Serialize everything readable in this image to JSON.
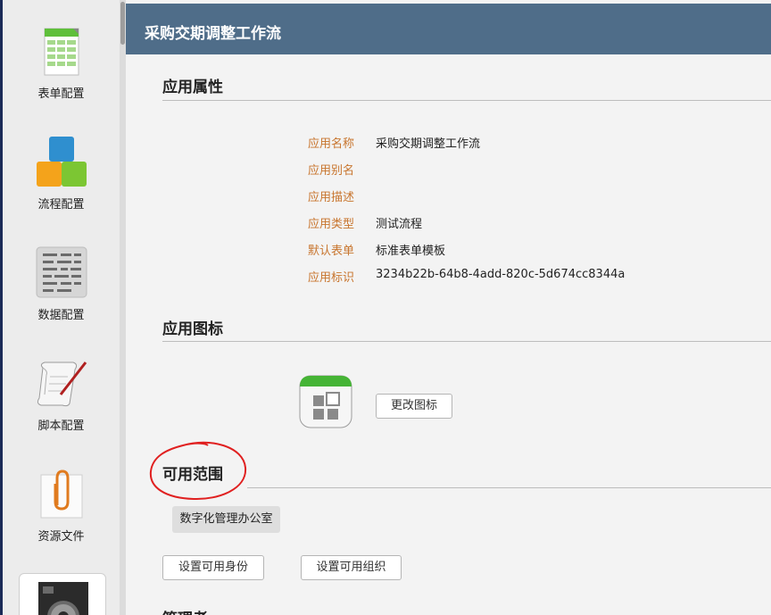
{
  "sidebar": {
    "items": [
      {
        "label": "表单配置",
        "icon": "form-table-icon"
      },
      {
        "label": "流程配置",
        "icon": "process-blocks-icon"
      },
      {
        "label": "数据配置",
        "icon": "data-grid-icon"
      },
      {
        "label": "脚本配置",
        "icon": "script-scroll-icon"
      },
      {
        "label": "资源文件",
        "icon": "paperclip-icon"
      },
      {
        "label": "",
        "icon": "settings-gear-icon"
      }
    ]
  },
  "header": {
    "title": "采购交期调整工作流"
  },
  "properties": {
    "section_title": "应用属性",
    "rows": [
      {
        "label": "应用名称",
        "value": "采购交期调整工作流"
      },
      {
        "label": "应用别名",
        "value": ""
      },
      {
        "label": "应用描述",
        "value": ""
      },
      {
        "label": "应用类型",
        "value": "测试流程"
      },
      {
        "label": "默认表单",
        "value": "标准表单模板"
      },
      {
        "label": "应用标识",
        "value": "3234b22b-64b8-4add-820c-5d674cc8344a"
      }
    ]
  },
  "icon_section": {
    "section_title": "应用图标",
    "change_label": "更改图标"
  },
  "scope_section": {
    "section_title": "可用范围",
    "tag": "数字化管理办公室",
    "set_identity_label": "设置可用身份",
    "set_org_label": "设置可用组织"
  },
  "admin_section": {
    "section_title": "管理者"
  },
  "colors": {
    "header_bg": "#4f6d89",
    "label_orange": "#c8752e",
    "annotation_red": "#e02020"
  }
}
